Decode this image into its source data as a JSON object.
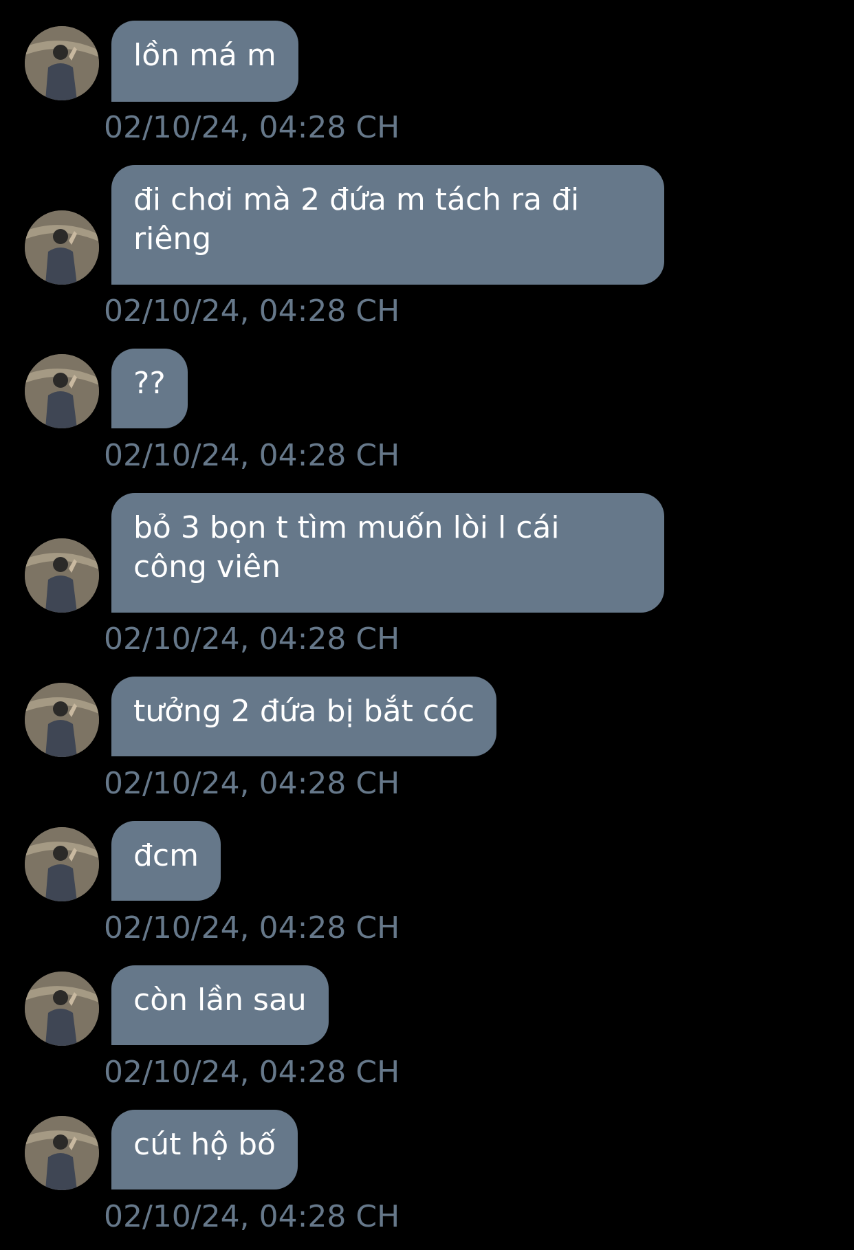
{
  "messages": [
    {
      "text": "lồn má m",
      "time": "02/10/24, 04:28 CH"
    },
    {
      "text": "đi chơi mà 2 đứa m tách ra đi\nriêng",
      "time": "02/10/24, 04:28 CH"
    },
    {
      "text": "??",
      "time": "02/10/24, 04:28 CH"
    },
    {
      "text": "bỏ 3 bọn t tìm muốn lòi l cái\ncông viên",
      "time": "02/10/24, 04:28 CH"
    },
    {
      "text": "tưởng 2 đứa bị bắt cóc",
      "time": "02/10/24, 04:28 CH"
    },
    {
      "text": "đcm",
      "time": "02/10/24, 04:28 CH"
    },
    {
      "text": "còn lần sau",
      "time": "02/10/24, 04:28 CH"
    },
    {
      "text": "cút hộ bố",
      "time": "02/10/24, 04:28 CH"
    }
  ],
  "colors": {
    "background": "#000000",
    "bubble": "#66788a",
    "bubble_text": "#ffffff",
    "timestamp": "#66788a"
  },
  "icons": {
    "avatar": "user-avatar-photo"
  }
}
